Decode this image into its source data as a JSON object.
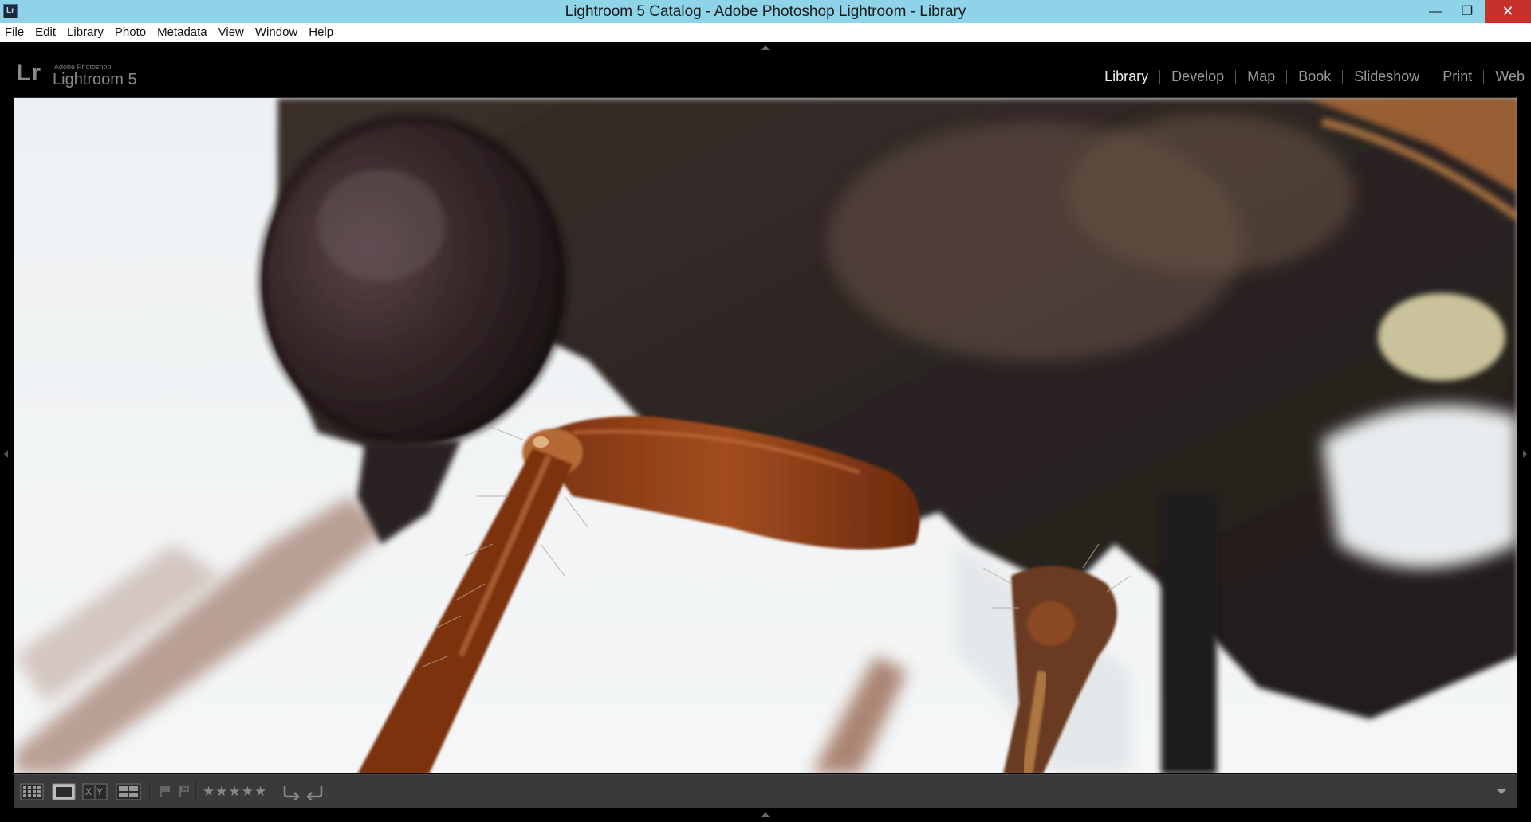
{
  "window": {
    "title": "Lightroom 5 Catalog - Adobe Photoshop Lightroom - Library",
    "app_icon": "Lr",
    "controls": [
      "minimize-icon",
      "maximize-icon",
      "close-icon"
    ]
  },
  "menubar": {
    "items": [
      "File",
      "Edit",
      "Library",
      "Photo",
      "Metadata",
      "View",
      "Window",
      "Help"
    ]
  },
  "logo": {
    "mark": "Lr",
    "adobe": "Adobe Photoshop",
    "product": "Lightroom 5"
  },
  "modules": {
    "items": [
      "Library",
      "Develop",
      "Map",
      "Book",
      "Slideshow",
      "Print",
      "Web"
    ],
    "active": "Library"
  },
  "photo": {
    "subject": "macro-insect-photo"
  },
  "toolbar": {
    "view_modes": [
      "grid-view-icon",
      "loupe-view-icon",
      "compare-view-icon",
      "survey-view-icon"
    ],
    "compare_label": "XY",
    "rating": "★★★★★",
    "rotate": [
      "rotate-left-icon",
      "rotate-right-icon"
    ]
  },
  "colors": {
    "titlebar": "#8fd3e8",
    "close": "#c7302b",
    "toolbar": "#3a3a3a",
    "active_module": "#ededed",
    "inactive_module": "#9a9a9a"
  }
}
